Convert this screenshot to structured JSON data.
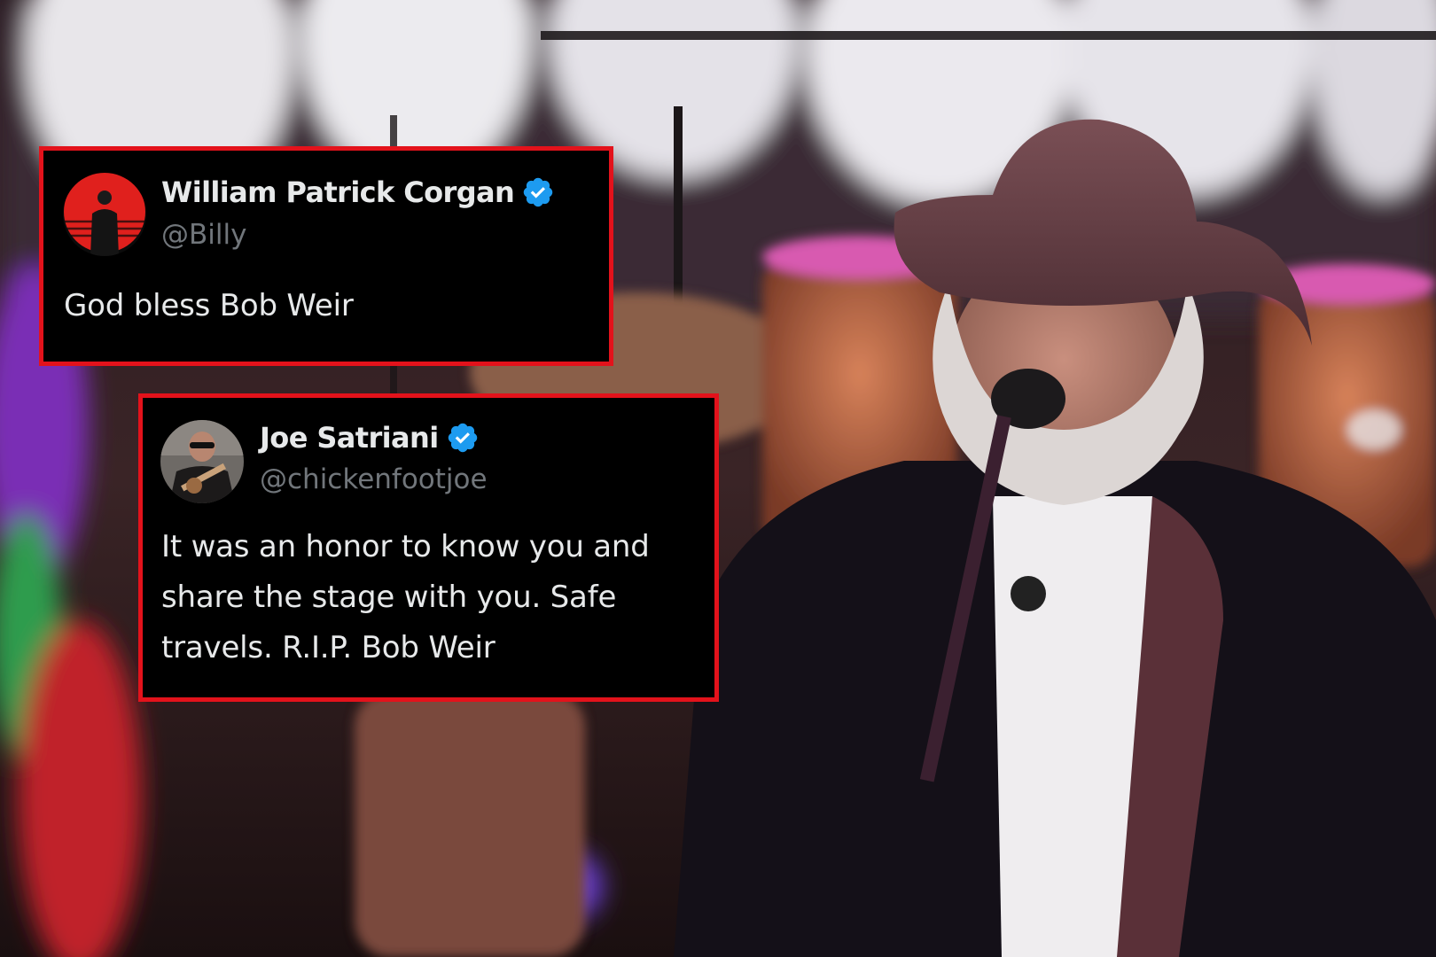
{
  "tweets": [
    {
      "display_name": "William Patrick Corgan",
      "handle": "@Billy",
      "verified": true,
      "text": "God bless Bob Weir",
      "avatar_icon": "red-sun-silhouette-avatar"
    },
    {
      "display_name": "Joe Satriani",
      "handle": "@chickenfootjoe",
      "verified": true,
      "text": "It was an honor to know you and share the stage with you. Safe travels. R.I.P. Bob Weir",
      "avatar_icon": "guitarist-photo-avatar"
    }
  ],
  "colors": {
    "card_border": "#e3121b",
    "card_background": "#000000",
    "verified_badge": "#1d9bf0",
    "handle_text": "#71767b"
  }
}
